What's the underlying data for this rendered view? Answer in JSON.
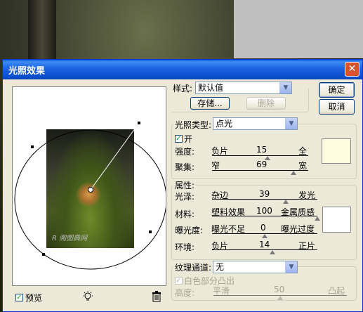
{
  "dialog": {
    "title": "光照效果",
    "close_label": "✕"
  },
  "style": {
    "label": "样式:",
    "value": "默认值",
    "save": "存储...",
    "delete": "删除"
  },
  "buttons": {
    "ok": "确定",
    "cancel": "取消"
  },
  "light_type": {
    "group_title": "光照类型:",
    "value": "点光",
    "on_label": "开",
    "on_checked": true,
    "intensity": {
      "label": "强度:",
      "left": "负片",
      "value": "15",
      "right": "全",
      "position": 0.58
    },
    "focus": {
      "label": "聚集:",
      "left": "窄",
      "value": "69",
      "right": "宽",
      "position": 0.845
    },
    "color": "#fffbe0"
  },
  "properties": {
    "group_title": "属性:",
    "gloss": {
      "label": "光泽:",
      "left": "杂边",
      "value": "39",
      "right": "发光",
      "position": 0.7
    },
    "material": {
      "label": "材料:",
      "left": "塑料效果",
      "value": "100",
      "right": "金属质感",
      "position": 1.0
    },
    "exposure": {
      "label": "曝光度:",
      "left": "曝光不足",
      "value": "0",
      "right": "曝光过度",
      "position": 0.5
    },
    "ambience": {
      "label": "环境:",
      "left": "负片",
      "value": "14",
      "right": "正片",
      "position": 0.57
    },
    "color": "#ffffff"
  },
  "texture": {
    "group_title": "纹理通道:",
    "value": "无",
    "white_high_label": "白色部分凸出",
    "white_high_checked": true,
    "height": {
      "label": "高度:",
      "left": "平滑",
      "value": "50",
      "right": "凸起",
      "position": 0.5
    }
  },
  "preview": {
    "label": "预览",
    "checked": true,
    "watermark": "R 阁图典网",
    "bulb_icon": "light-bulb-icon",
    "trash_icon": "trash-icon"
  }
}
